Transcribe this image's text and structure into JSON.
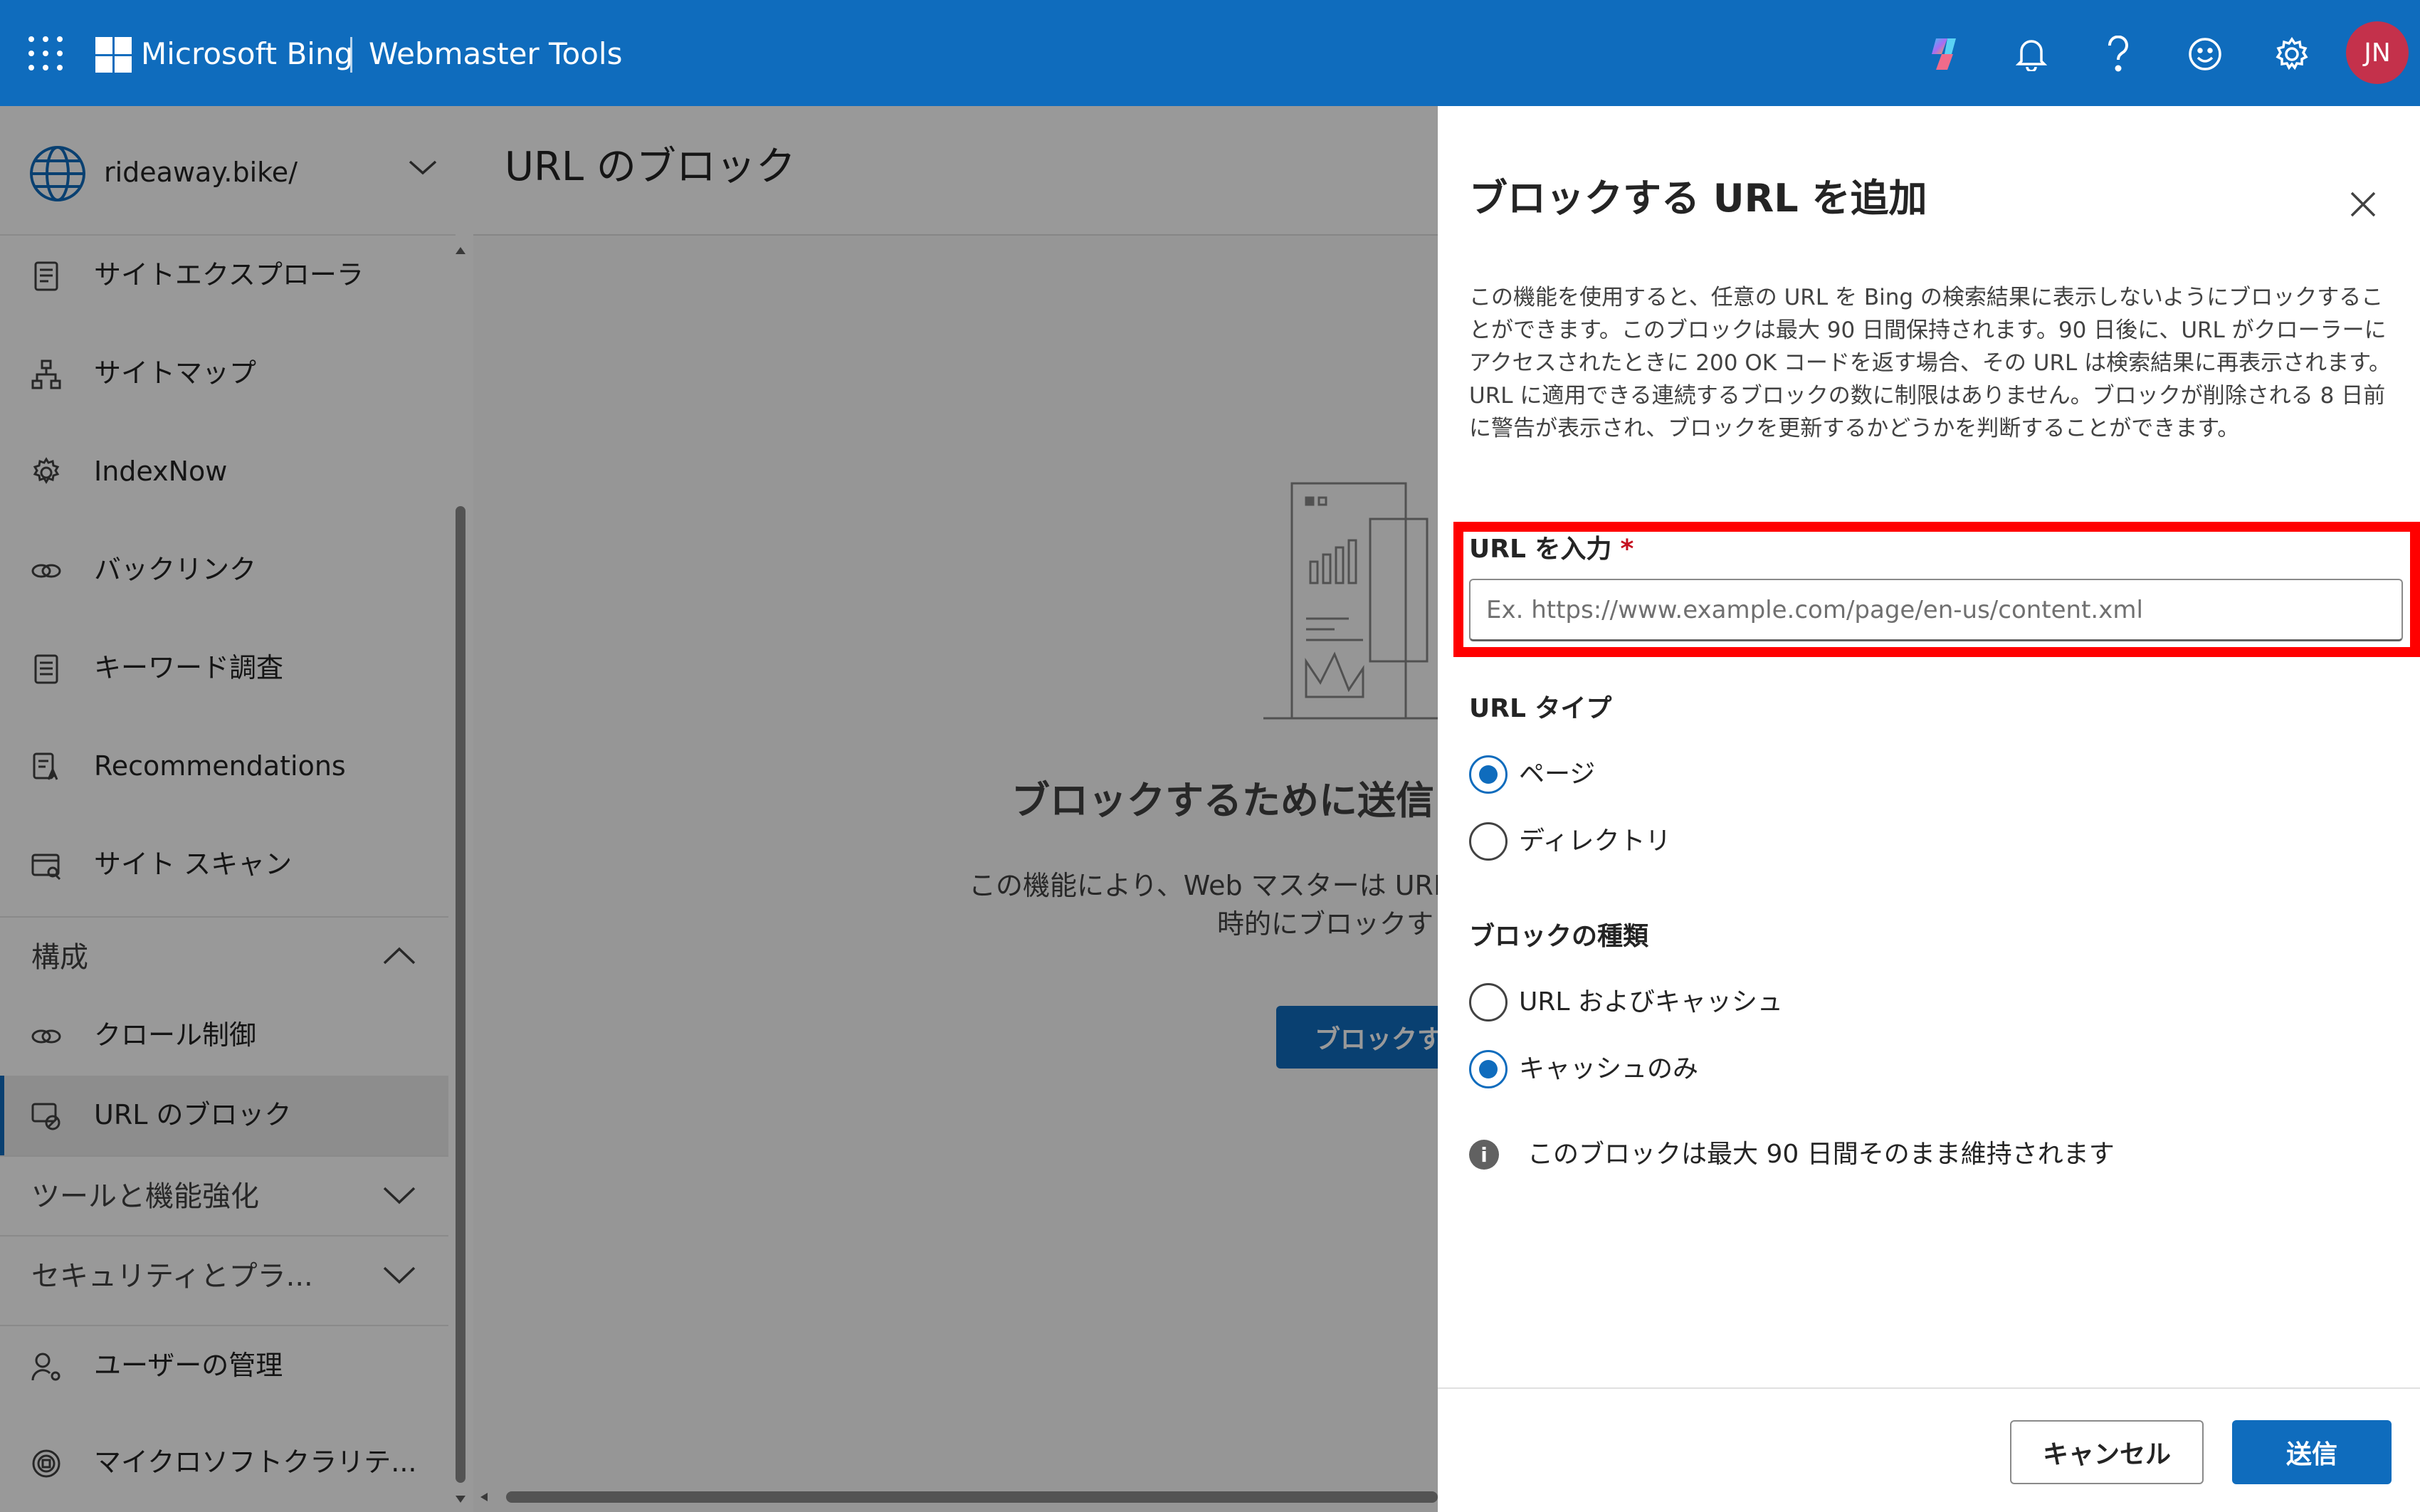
{
  "topbar": {
    "brand": "Microsoft Bing",
    "product": "Webmaster Tools",
    "avatar_initials": "JN",
    "icons": [
      "waffle-icon",
      "copilot-icon",
      "bell-icon",
      "help-icon",
      "feedback-smiley-icon",
      "gear-icon"
    ]
  },
  "sidebar": {
    "site": "rideaway.bike/",
    "items": [
      {
        "label": "サイトエクスプローラ",
        "icon": "site-explorer-icon"
      },
      {
        "label": "サイトマップ",
        "icon": "sitemap-icon"
      },
      {
        "label": "IndexNow",
        "icon": "indexnow-gear-icon"
      },
      {
        "label": "バックリンク",
        "icon": "link-icon"
      },
      {
        "label": "キーワード調査",
        "icon": "document-icon"
      },
      {
        "label": "Recommendations",
        "icon": "recommendations-icon"
      },
      {
        "label": "サイト スキャン",
        "icon": "site-scan-icon"
      }
    ],
    "group_config": "構成",
    "config_items": [
      {
        "label": "クロール制御",
        "icon": "link-icon"
      },
      {
        "label": "URL のブロック",
        "icon": "block-url-icon",
        "selected": true
      }
    ],
    "group_tools": "ツールと機能強化",
    "group_security": "セキュリティとプラ...",
    "bottom_items": [
      {
        "label": "ユーザーの管理",
        "icon": "user-settings-icon"
      },
      {
        "label": "マイクロソフトクラリテ...",
        "icon": "clarity-icon"
      }
    ]
  },
  "main": {
    "title": "URL のブロック",
    "empty_title": "ブロックするために送信",
    "empty_desc_line1": "この機能により、Web マスターは URL",
    "empty_desc_line2": "時的にブロックす",
    "button": "ブロックする"
  },
  "panel": {
    "title": "ブロックする URL を追加",
    "description": "この機能を使用すると、任意の URL を Bing の検索結果に表示しないようにブロックすることができます。このブロックは最大 90 日間保持されます。90 日後に、URL がクローラーにアクセスされたときに 200 OK コードを返す場合、その URL は検索結果に再表示されます。URL に適用できる連続するブロックの数に制限はありません。ブロックが削除される 8 日前に警告が表示され、ブロックを更新するかどうかを判断することができます。",
    "url_label": "URL を入力",
    "required_mark": "*",
    "url_value": "",
    "url_placeholder": "Ex. https://www.example.com/page/en-us/content.xml",
    "url_type_label": "URL タイプ",
    "url_type_options": [
      {
        "label": "ページ",
        "checked": true
      },
      {
        "label": "ディレクトリ",
        "checked": false
      }
    ],
    "block_kind_label": "ブロックの種類",
    "block_kind_options": [
      {
        "label": "URL およびキャッシュ",
        "checked": false
      },
      {
        "label": "キャッシュのみ",
        "checked": true
      }
    ],
    "info_text": "このブロックは最大 90 日間そのまま維持されます",
    "cancel": "キャンセル",
    "submit": "送信"
  },
  "colors": {
    "topbar": "#0f6cbd",
    "primary_button": "#0f6cbd",
    "highlight_box": "#ff0000",
    "avatar": "#c4314b"
  }
}
